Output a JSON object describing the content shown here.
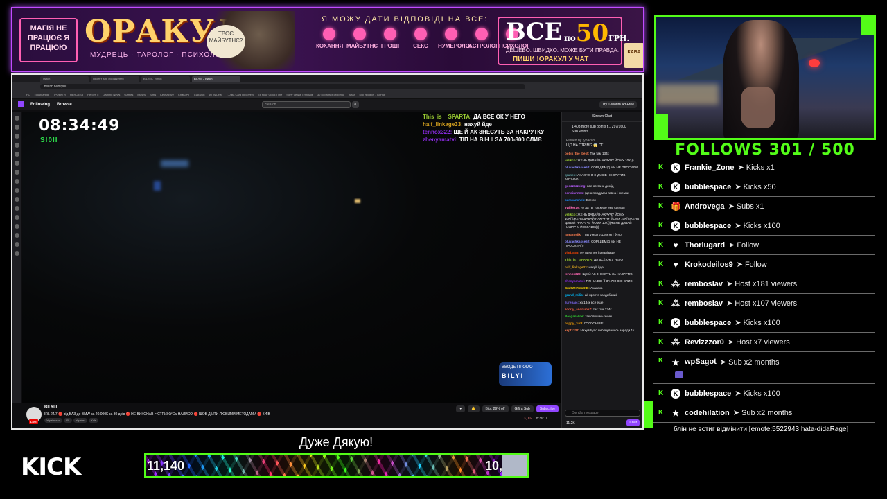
{
  "banner": {
    "not_work": "МАГІЯ НЕ ПРАЦЮЄ Я ПРАЦЮЮ",
    "oracle": "ОРАКУЛ",
    "oracle_sub": "МУДРЕЦЬ · ТАРОЛОГ · ПСИХОЛОГ",
    "wizard_bubble": "ТВОЄ МАЙБУТНЄ?",
    "answers": "Я МОЖУ ДАТИ ВІДПОВІДІ НА ВСЕ:",
    "topics": [
      "КОХАННЯ",
      "МАЙБУТНЄ",
      "ГРОШІ",
      "СЕКС",
      "НУМЕРОЛОГ",
      "АСТРОЛОГ",
      "ПСИХОЛОГ"
    ],
    "price_all": "ВСЕ",
    "price_num": "50",
    "price_unit": "по",
    "price_cur": "ГРН.",
    "price_sub": "ДЕШЕВО. ШВИДКО. МОЖЕ БУТИ ПРАВДА.",
    "price_cta": "ПИШИ !ОРАКУЛ У ЧАТ",
    "cup": "КАВА"
  },
  "browser": {
    "tabs": [
      "Twitch",
      "Проект для обходження",
      "BILYIII - Twitch",
      "BILYIII - Twitch"
    ],
    "url": "twitch.tv/bilyiiii",
    "bookmarks": [
      "PC",
      "Посилання",
      "ПРОЕКТИ",
      "HEROES3",
      "Heroes 5",
      "Gaming News",
      "Games",
      "MODS",
      "Sims",
      "KeysActive",
      "ChatGPT",
      "CLAUDE",
      "AI_WORK",
      "7-Data Card Recovery",
      "24 Hour Clock Time",
      "Sony Vegas Template",
      "30 корисних сторінок",
      "Вітає",
      "Мої профілі - GitHub"
    ],
    "nav_following": "Following",
    "nav_browse": "Browse",
    "search_placeholder": "Search",
    "adfree": "Try 1-Month Ad-Free"
  },
  "video": {
    "clock": "08:34:49",
    "speed": "SI0II",
    "overlay_chat": [
      {
        "user": "This_is__SPARTA:",
        "text": "ДА ВСЁ ОК У НЕГО"
      },
      {
        "user": "half_linkage33:",
        "text": "нахуй йде"
      },
      {
        "user": "tennox322:",
        "text": "ЩЕ Й АК ЗНЕСУТЬ ЗА НАКРУТКУ"
      },
      {
        "user": "zhenyamatvi:",
        "text": "ТІП НА ВІН ЇЇ ЗА 700-800 СЛИЄ"
      }
    ],
    "promo_label": "ВВОДЬ ПРОМО",
    "promo_name": "BILYI"
  },
  "stream_info": {
    "live": "LIVE",
    "channel": "BILYIII",
    "title": "IRL 24/7 🔴 від ВАЗ до BMW за 20.000$ за 30 днів 🔴 НЕ ВИКОНАВ = СТРИЖУСЬ НАЛИСО 🔴 ЩОБ ДІЙТИ ЛЮБИМИ МЕТОДАМИ 🔴 КИЇВ",
    "tags": [
      "Українська",
      "IRL",
      "Україна",
      "Київ"
    ],
    "bits": "Bits: 29% off",
    "gift": "Gift a Sub",
    "subscribe": "Subscribe",
    "viewers": "3,002",
    "uptime": "8:36:11"
  },
  "chat": {
    "header": "Stream Chat",
    "subgoal": "1,403 more sub points t... 297/1600 Sub Points",
    "pinned_by": "Pinned by rybacco",
    "pinned": "ЩО НА СТРІМІ? 😱 СТ...",
    "messages": [
      {
        "user": "bobik_the_best:",
        "text": "Так там 134к",
        "color": "#ff7f50"
      },
      {
        "user": "velikco:",
        "text": "ЖЕНЬ ДАВАЙ НАКРУЧУ ЙОМУ 10К)))",
        "color": "#9acd32"
      },
      {
        "user": "pluvachkasse52:",
        "text": "СОРІ ДЕМІД МИ НЕ ПРОСИЛИ",
        "color": "#8a8aff"
      },
      {
        "user": "qrunek:",
        "text": "АХАХАХ Я ІНДУСІВ НЕ КРУТИВ АВТІЧАО",
        "color": "#5f9ea0"
      },
      {
        "user": "gonzzzzzking:",
        "text": "все отстань демід",
        "color": "#b95fff"
      },
      {
        "user": "certainnnnn:",
        "text": "(цею придумав гавна і схемки",
        "color": "#b95fff"
      },
      {
        "user": "paravanchek:",
        "text": "Все ок",
        "color": "#1e90ff"
      },
      {
        "user": "Twilkerzy:",
        "text": "ну да ты ток хуже ему сделал",
        "color": "#ff69b4"
      },
      {
        "user": "velikco:",
        "text": "ЖЕНЬ ДАВАЙ НАКРУЧУ ЙОМУ 10К)))ЖЕНЬ ДАВАЙ НАКРУЧУ ЙОМУ 10К)))ЖЕНЬ ДАВАЙ НАКРУЧУ ЙОМУ 10К)))ЖЕНЬ ДАВАЙ НАКРУЧУ ЙОМУ 10К)))",
        "color": "#9acd32"
      },
      {
        "user": "tomatoslik_:",
        "text": "так у нього 134к як і було!",
        "color": "#ff7f50"
      },
      {
        "user": "pluvachkasse52:",
        "text": "СОРІ ДЕМІД МИ НЕ ПРОСИЛИ)))",
        "color": "#8a8aff"
      },
      {
        "user": "vlad3456:",
        "text": "Ну їдем тех і реалізація",
        "color": "#ff4500"
      },
      {
        "user": "This_is__SPARTA:",
        "text": "ДА ВСЁ ОК У НЕГО",
        "color": "#9acd32"
      },
      {
        "user": "half_linkage33:",
        "text": "нахуй йде",
        "color": "#daa520"
      },
      {
        "user": "tennox322:",
        "text": "ЩЕ Й АК ЗНЕСУТЬ ЗА НАКРУТКУ",
        "color": "#ff69b4"
      },
      {
        "user": "zhenyamatvi:",
        "text": "ТІП НА ВІН ЇЇ ЗА 700-800 СЛИЄ",
        "color": "#8a2be2"
      },
      {
        "user": "SmitWHYnotXD:",
        "text": "Ахахаха",
        "color": "#ffd700"
      },
      {
        "user": "grand_milio:",
        "text": "ай просто заєдабаний",
        "color": "#00bfff"
      },
      {
        "user": "zurenaic:",
        "text": "хз 134к все еще",
        "color": "#7b68ee"
      },
      {
        "user": "zodriy_andriuha7:",
        "text": "так там 134к",
        "color": "#ff6347"
      },
      {
        "user": "ReaganNine:",
        "text": "так слишись зимы",
        "color": "#32cd32"
      },
      {
        "user": "happy_zunl:",
        "text": "ГОЛОСНІШЕ",
        "color": "#ffa500"
      },
      {
        "user": "kept1337:",
        "text": "Нахуй було вибобувались заради 1к",
        "color": "#ff7f50"
      }
    ],
    "input_placeholder": "Send a message",
    "points": "11.2K",
    "chat_button": "Chat"
  },
  "follows": "FOLLOWS 301 / 500",
  "events": [
    {
      "icon": "kick",
      "name": "Frankie_Zone",
      "action": "➤ Kicks x1"
    },
    {
      "icon": "kick",
      "name": "bubblespace",
      "action": "➤ Kicks x50"
    },
    {
      "icon": "gift",
      "name": "Androvega",
      "action": "➤ Subs x1"
    },
    {
      "icon": "kick",
      "name": "bubblespace",
      "action": "➤ Kicks x100"
    },
    {
      "icon": "heart",
      "name": "Thorlugard",
      "action": "➤ Follow"
    },
    {
      "icon": "heart",
      "name": "Krokodeilos9",
      "action": "➤ Follow"
    },
    {
      "icon": "host",
      "name": "remboslav",
      "action": "➤ Host x181 viewers"
    },
    {
      "icon": "host",
      "name": "remboslav",
      "action": "➤ Host x107 viewers"
    },
    {
      "icon": "kick",
      "name": "bubblespace",
      "action": "➤ Kicks x100"
    },
    {
      "icon": "host",
      "name": "Revizzzor0",
      "action": "➤ Host x7 viewers"
    },
    {
      "icon": "star",
      "name": "wpSagot",
      "action": "➤ Sub x2 months"
    },
    {
      "icon": "kick",
      "name": "bubblespace",
      "action": "➤ Kicks x100"
    },
    {
      "icon": "star",
      "name": "codehilation",
      "action": "➤ Sub x2 months"
    }
  ],
  "last_event_message": "блін не встиг відмінити [emote:5522943:hata-didaRage]",
  "kick_logo": "KICK",
  "thanks": "Дуже Дякую!",
  "goal": {
    "left": "11,140",
    "right": "10,"
  }
}
